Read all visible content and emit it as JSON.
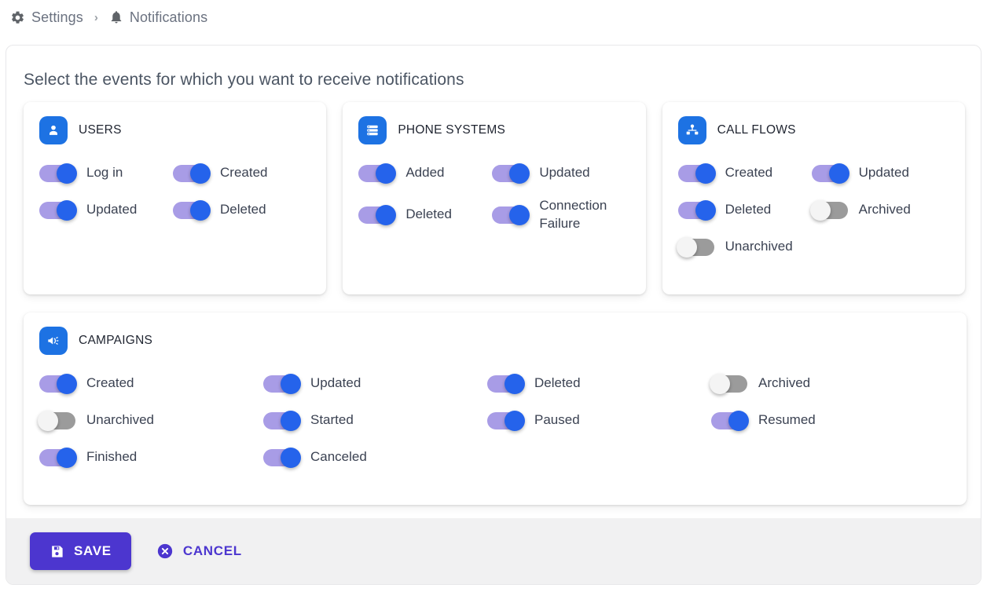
{
  "breadcrumb": {
    "items": [
      {
        "label": "Settings",
        "icon": "gear-icon"
      },
      {
        "label": "Notifications",
        "icon": "bell-icon"
      }
    ],
    "separator": "›"
  },
  "main": {
    "heading": "Select the events for which you want to receive notifications",
    "cards": [
      {
        "id": "users",
        "title": "USERS",
        "icon": "person-icon",
        "icon_color": "#1d72e3",
        "toggles": [
          {
            "label": "Log in",
            "on": true
          },
          {
            "label": "Created",
            "on": true
          },
          {
            "label": "Updated",
            "on": true
          },
          {
            "label": "Deleted",
            "on": true
          }
        ]
      },
      {
        "id": "phone-systems",
        "title": "PHONE SYSTEMS",
        "icon": "server-icon",
        "icon_color": "#1d72e3",
        "toggles": [
          {
            "label": "Added",
            "on": true
          },
          {
            "label": "Updated",
            "on": true
          },
          {
            "label": "Deleted",
            "on": true
          },
          {
            "label": "Connection Failure",
            "on": true
          }
        ]
      },
      {
        "id": "call-flows",
        "title": "CALL FLOWS",
        "icon": "flow-node-icon",
        "icon_color": "#1d72e3",
        "toggles": [
          {
            "label": "Created",
            "on": true
          },
          {
            "label": "Updated",
            "on": true
          },
          {
            "label": "Deleted",
            "on": true
          },
          {
            "label": "Archived",
            "on": false
          },
          {
            "label": "Unarchived",
            "on": false
          }
        ]
      },
      {
        "id": "campaigns",
        "title": "CAMPAIGNS",
        "icon": "megaphone-icon",
        "icon_color": "#1d72e3",
        "toggles": [
          {
            "label": "Created",
            "on": true
          },
          {
            "label": "Updated",
            "on": true
          },
          {
            "label": "Deleted",
            "on": true
          },
          {
            "label": "Archived",
            "on": false
          },
          {
            "label": "Unarchived",
            "on": false
          },
          {
            "label": "Started",
            "on": true
          },
          {
            "label": "Paused",
            "on": true
          },
          {
            "label": "Resumed",
            "on": true
          },
          {
            "label": "Finished",
            "on": true
          },
          {
            "label": "Canceled",
            "on": true
          }
        ]
      }
    ]
  },
  "footer": {
    "save_label": "SAVE",
    "cancel_label": "CANCEL",
    "save_icon": "floppy-disk-icon",
    "cancel_icon": "circle-x-icon",
    "accent_color": "#4c36cf"
  },
  "colors": {
    "toggle_on_track": "#a89ce6",
    "toggle_on_thumb": "#2563eb",
    "toggle_off_track": "#9b9b9b",
    "toggle_off_thumb": "#f4f4f4",
    "icon_badge": "#1d72e3",
    "purple_accent": "#4c36cf"
  }
}
